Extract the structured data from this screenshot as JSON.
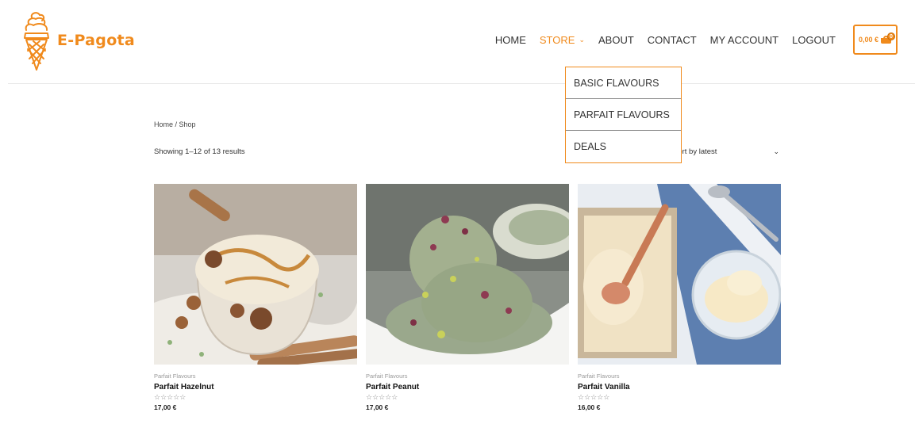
{
  "brand": {
    "name": "E-Pagota",
    "accent": "#f08a1c"
  },
  "nav": {
    "items": [
      {
        "label": "HOME"
      },
      {
        "label": "STORE",
        "active": true
      },
      {
        "label": "ABOUT"
      },
      {
        "label": "CONTACT"
      },
      {
        "label": "MY ACCOUNT"
      },
      {
        "label": "LOGOUT"
      }
    ],
    "cart": {
      "amount": "0,00 €",
      "count": "0",
      "icon": "basket-icon"
    }
  },
  "store_dropdown": {
    "items": [
      "BASIC FLAVOURS",
      "PARFAIT FLAVOURS",
      "DEALS"
    ]
  },
  "shop": {
    "breadcrumb": "Home / Shop",
    "result_count": "Showing 1–12 of 13 results",
    "sort_label": "Sort by latest",
    "products": [
      {
        "category": "Parfait Flavours",
        "name": "Parfait Hazelnut",
        "rating_stars": "☆☆☆☆☆",
        "price": "17,00 €"
      },
      {
        "category": "Parfait Flavours",
        "name": "Parfait Peanut",
        "rating_stars": "☆☆☆☆☆",
        "price": "17,00 €"
      },
      {
        "category": "Parfait Flavours",
        "name": "Parfait Vanilla",
        "rating_stars": "☆☆☆☆☆",
        "price": "16,00 €"
      }
    ]
  }
}
